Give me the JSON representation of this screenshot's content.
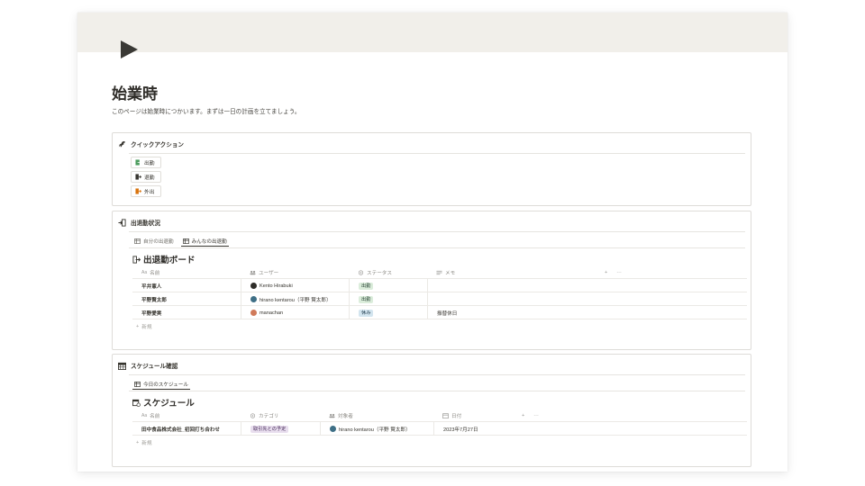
{
  "page": {
    "title": "始業時",
    "description": "このページは始業時につかいます。まずは一日の計画を立てましょう。",
    "icon": "play-triangle-icon",
    "cover_color": "#f1efea"
  },
  "quick_actions": {
    "title": "クイックアクション",
    "icon": "horse-icon",
    "buttons": [
      {
        "label": "出勤",
        "icon": "clock-in-icon",
        "color": "#4d9c5e"
      },
      {
        "label": "退勤",
        "icon": "clock-out-icon",
        "color": "#37352f"
      },
      {
        "label": "外出",
        "icon": "go-out-icon",
        "color": "#d9730d"
      }
    ]
  },
  "attendance": {
    "title": "出退勤状況",
    "icon": "door-enter-icon",
    "tabs": [
      {
        "label": "自分の出退勤",
        "active": false
      },
      {
        "label": "みんなの出退勤",
        "active": true
      }
    ],
    "db_title": "出退勤ボード",
    "columns": [
      "名前",
      "ユーザー",
      "ステータス",
      "メモ"
    ],
    "column_icons": [
      "Aa",
      "people-icon",
      "status-icon",
      "text-icon"
    ],
    "rows": [
      {
        "name": "平井憲人",
        "user": "Kento Hirabuki",
        "status": "出勤",
        "status_color": "green",
        "memo": ""
      },
      {
        "name": "平野賢太郎",
        "user": "hirano kentarou（平野 賢太郎）",
        "status": "出勤",
        "status_color": "green",
        "memo": ""
      },
      {
        "name": "平野愛実",
        "user": "manachan",
        "status": "休み",
        "status_color": "blue",
        "memo": "振替休日"
      }
    ],
    "new_label": "新規",
    "add_symbol": "+",
    "more_symbol": "···"
  },
  "schedule": {
    "title": "スケジュール確認",
    "icon": "calendar-icon",
    "tabs": [
      {
        "label": "今日のスケジュール",
        "active": true
      }
    ],
    "db_title": "スケジュール",
    "columns": [
      "名前",
      "カテゴリ",
      "対象者",
      "日付"
    ],
    "column_icons": [
      "Aa",
      "status-icon",
      "people-icon",
      "calendar-small-icon"
    ],
    "rows": [
      {
        "name": "田中食品株式会社_初回打ち合わせ",
        "category": "取引先との予定",
        "category_color": "purple",
        "assignee": "hirano kentarou（平野 賢太郎）",
        "date": "2023年7月27日"
      }
    ],
    "new_label": "新規",
    "add_symbol": "+",
    "more_symbol": "···"
  }
}
